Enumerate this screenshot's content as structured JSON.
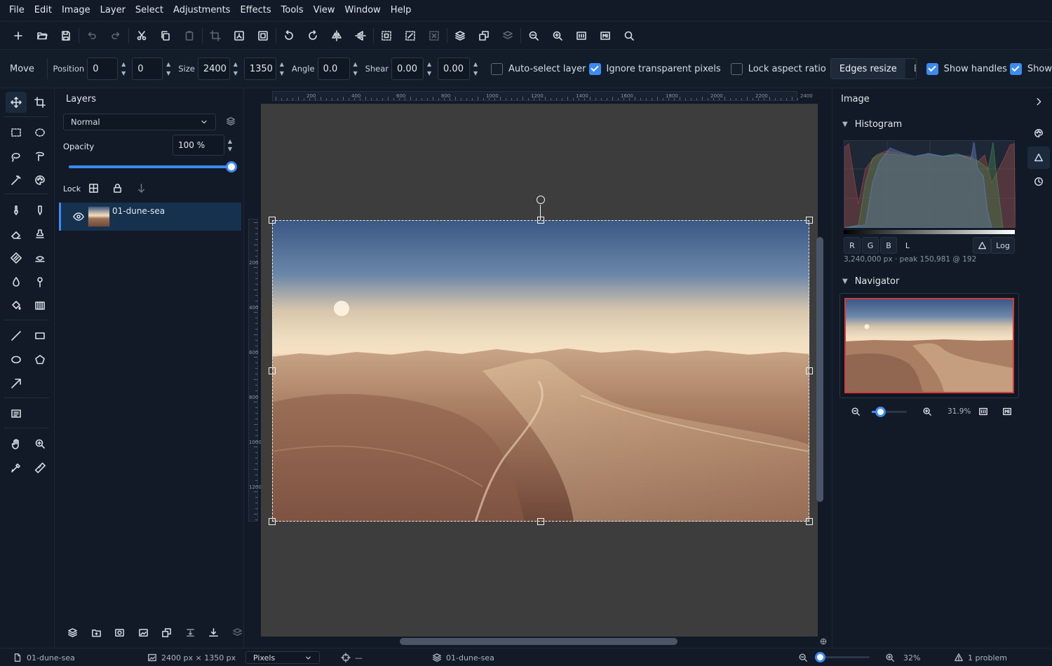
{
  "menu": [
    "File",
    "Edit",
    "Image",
    "Layer",
    "Select",
    "Adjustments",
    "Effects",
    "Tools",
    "View",
    "Window",
    "Help"
  ],
  "options": {
    "tool_title": "Move",
    "position_label": "Position",
    "pos_x": "0",
    "pos_y": "0",
    "size_label": "Size",
    "width": "2400",
    "height": "1350",
    "angle_label": "Angle",
    "angle": "0.0",
    "shear_label": "Shear",
    "shear_x": "0.00",
    "shear_y": "0.00",
    "auto_select": {
      "label": "Auto-select layer",
      "checked": false
    },
    "ignore_transparent": {
      "label": "Ignore transparent pixels",
      "checked": true
    },
    "lock_aspect": {
      "label": "Lock aspect ratio",
      "checked": false
    },
    "edges_resize": "Edges resize",
    "edges_rotate": "Edges rotate",
    "show_handles": {
      "label": "Show handles",
      "checked": true
    },
    "show_other": {
      "label": "Show",
      "checked": true
    }
  },
  "layers": {
    "title": "Layers",
    "blend_mode": "Normal",
    "opacity_label": "Opacity",
    "opacity_value": "100 %",
    "opacity_fraction": 1.0,
    "lock_label": "Lock",
    "items": [
      {
        "name": "01-dune-sea",
        "visible": true
      }
    ]
  },
  "rulers": {
    "h_labels": [
      "200",
      "400",
      "600",
      "800",
      "1000",
      "1200",
      "1400",
      "1600",
      "1800",
      "2000",
      "2200",
      "2400"
    ],
    "v_labels": [
      "200",
      "400",
      "600",
      "800",
      "1000",
      "1200"
    ]
  },
  "right_panel": {
    "title": "Image",
    "histogram_title": "Histogram",
    "channels": [
      "R",
      "G",
      "B",
      "L"
    ],
    "log_label": "Log",
    "histogram_stats": "3,240,000 px · peak 150,981 @ 192",
    "navigator_title": "Navigator",
    "zoom_percent": "31.9%"
  },
  "status": {
    "document": "01-dune-sea",
    "dimensions": "2400 px × 1350 px",
    "units": "Pixels",
    "cursor": "—",
    "layer": "01-dune-sea",
    "zoom": "32%",
    "problems": "1 problem"
  },
  "colors": {
    "accent": "#3d8bf0",
    "background": "#111a26",
    "canvas_bg": "#3d3d3d",
    "navigator_frame": "#d23c3c"
  }
}
